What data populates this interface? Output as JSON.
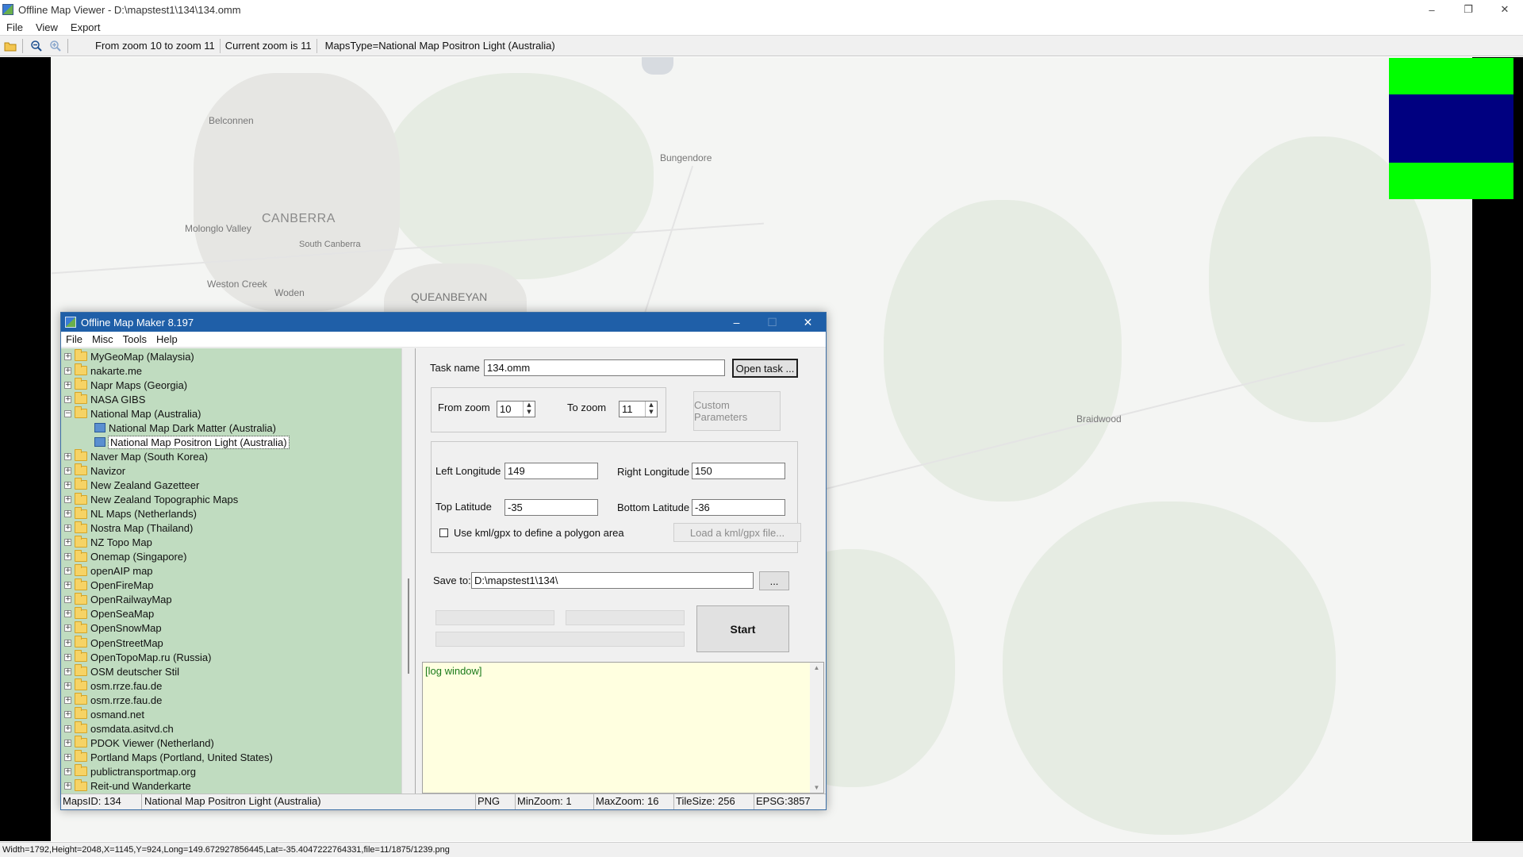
{
  "window": {
    "title": "Offline Map Viewer - D:\\mapstest1\\134\\134.omm",
    "controls": [
      "–",
      "❐",
      "✕"
    ]
  },
  "menu": [
    "File",
    "View",
    "Export"
  ],
  "toolbar": {
    "zoom_range": "From zoom 10 to zoom 11",
    "current_zoom": "Current zoom is 11",
    "maps_type": "MapsType=National Map Positron Light (Australia)"
  },
  "map": {
    "labels": {
      "belconnen": "Belconnen",
      "bungendore": "Bungendore",
      "canberra": "CANBERRA",
      "molonglo": "Molonglo Valley",
      "south_canberra": "South Canberra",
      "weston_creek": "Weston Creek",
      "woden": "Woden",
      "queanbeyan": "QUEANBEYAN",
      "braidwood": "Braidwood"
    },
    "overlay_colors": [
      "#00ff00",
      "#000080",
      "#00ff00"
    ]
  },
  "status_line": "Width=1792,Height=2048,X=1145,Y=924,Long=149.672927856445,Lat=-35.4047222764331,file=11/1875/1239.png",
  "dialog": {
    "title": "Offline Map Maker 8.197",
    "menu": [
      "File",
      "Misc",
      "Tools",
      "Help"
    ],
    "tree": [
      {
        "label": "MyGeoMap (Malaysia)",
        "expanded": false
      },
      {
        "label": "nakarte.me",
        "expanded": false
      },
      {
        "label": "Napr Maps (Georgia)",
        "expanded": false
      },
      {
        "label": "NASA GIBS",
        "expanded": false
      },
      {
        "label": "National Map (Australia)",
        "expanded": true
      },
      {
        "label": "National Map Dark Matter (Australia)",
        "child": true
      },
      {
        "label": "National Map Positron Light (Australia)",
        "child": true,
        "selected": true
      },
      {
        "label": "Naver Map (South Korea)",
        "expanded": false
      },
      {
        "label": "Navizor",
        "expanded": false
      },
      {
        "label": "New Zealand Gazetteer",
        "expanded": false
      },
      {
        "label": "New Zealand Topographic Maps",
        "expanded": false
      },
      {
        "label": "NL Maps (Netherlands)",
        "expanded": false
      },
      {
        "label": "Nostra Map (Thailand)",
        "expanded": false
      },
      {
        "label": "NZ Topo Map",
        "expanded": false
      },
      {
        "label": "Onemap (Singapore)",
        "expanded": false
      },
      {
        "label": "openAIP map",
        "expanded": false
      },
      {
        "label": "OpenFireMap",
        "expanded": false
      },
      {
        "label": "OpenRailwayMap",
        "expanded": false
      },
      {
        "label": "OpenSeaMap",
        "expanded": false
      },
      {
        "label": "OpenSnowMap",
        "expanded": false
      },
      {
        "label": "OpenStreetMap",
        "expanded": false
      },
      {
        "label": "OpenTopoMap.ru (Russia)",
        "expanded": false
      },
      {
        "label": "OSM deutscher Stil",
        "expanded": false
      },
      {
        "label": "osm.rrze.fau.de",
        "expanded": false
      },
      {
        "label": "osm.rrze.fau.de",
        "expanded": false
      },
      {
        "label": "osmand.net",
        "expanded": false
      },
      {
        "label": "osmdata.asitvd.ch",
        "expanded": false
      },
      {
        "label": "PDOK Viewer (Netherland)",
        "expanded": false
      },
      {
        "label": "Portland Maps (Portland, United States)",
        "expanded": false
      },
      {
        "label": "publictransportmap.org",
        "expanded": false
      },
      {
        "label": "Reit-und Wanderkarte",
        "expanded": false
      }
    ],
    "form": {
      "task_name_label": "Task name",
      "task_name_value": "134.omm",
      "open_task_label": "Open task ...",
      "from_zoom_label": "From zoom",
      "from_zoom_value": "10",
      "to_zoom_label": "To zoom",
      "to_zoom_value": "11",
      "custom_params_label": "Custom Parameters",
      "left_lon_label": "Left Longitude",
      "left_lon_value": "149",
      "right_lon_label": "Right Longitude",
      "right_lon_value": "150",
      "top_lat_label": "Top Latitude",
      "top_lat_value": "-35",
      "bottom_lat_label": "Bottom Latitude",
      "bottom_lat_value": "-36",
      "kml_checkbox_label": "Use kml/gpx to define a polygon area",
      "load_kml_label": "Load a kml/gpx file...",
      "save_to_label": "Save to:",
      "save_to_value": "D:\\mapstest1\\134\\",
      "browse_label": "...",
      "start_label": "Start",
      "log_text": "[log window]"
    },
    "status": {
      "maps_id": "MapsID: 134",
      "map_name": "National Map Positron Light (Australia)",
      "format": "PNG",
      "min_zoom": "MinZoom: 1",
      "max_zoom": "MaxZoom: 16",
      "tile_size": "TileSize: 256",
      "epsg": "EPSG:3857"
    }
  }
}
